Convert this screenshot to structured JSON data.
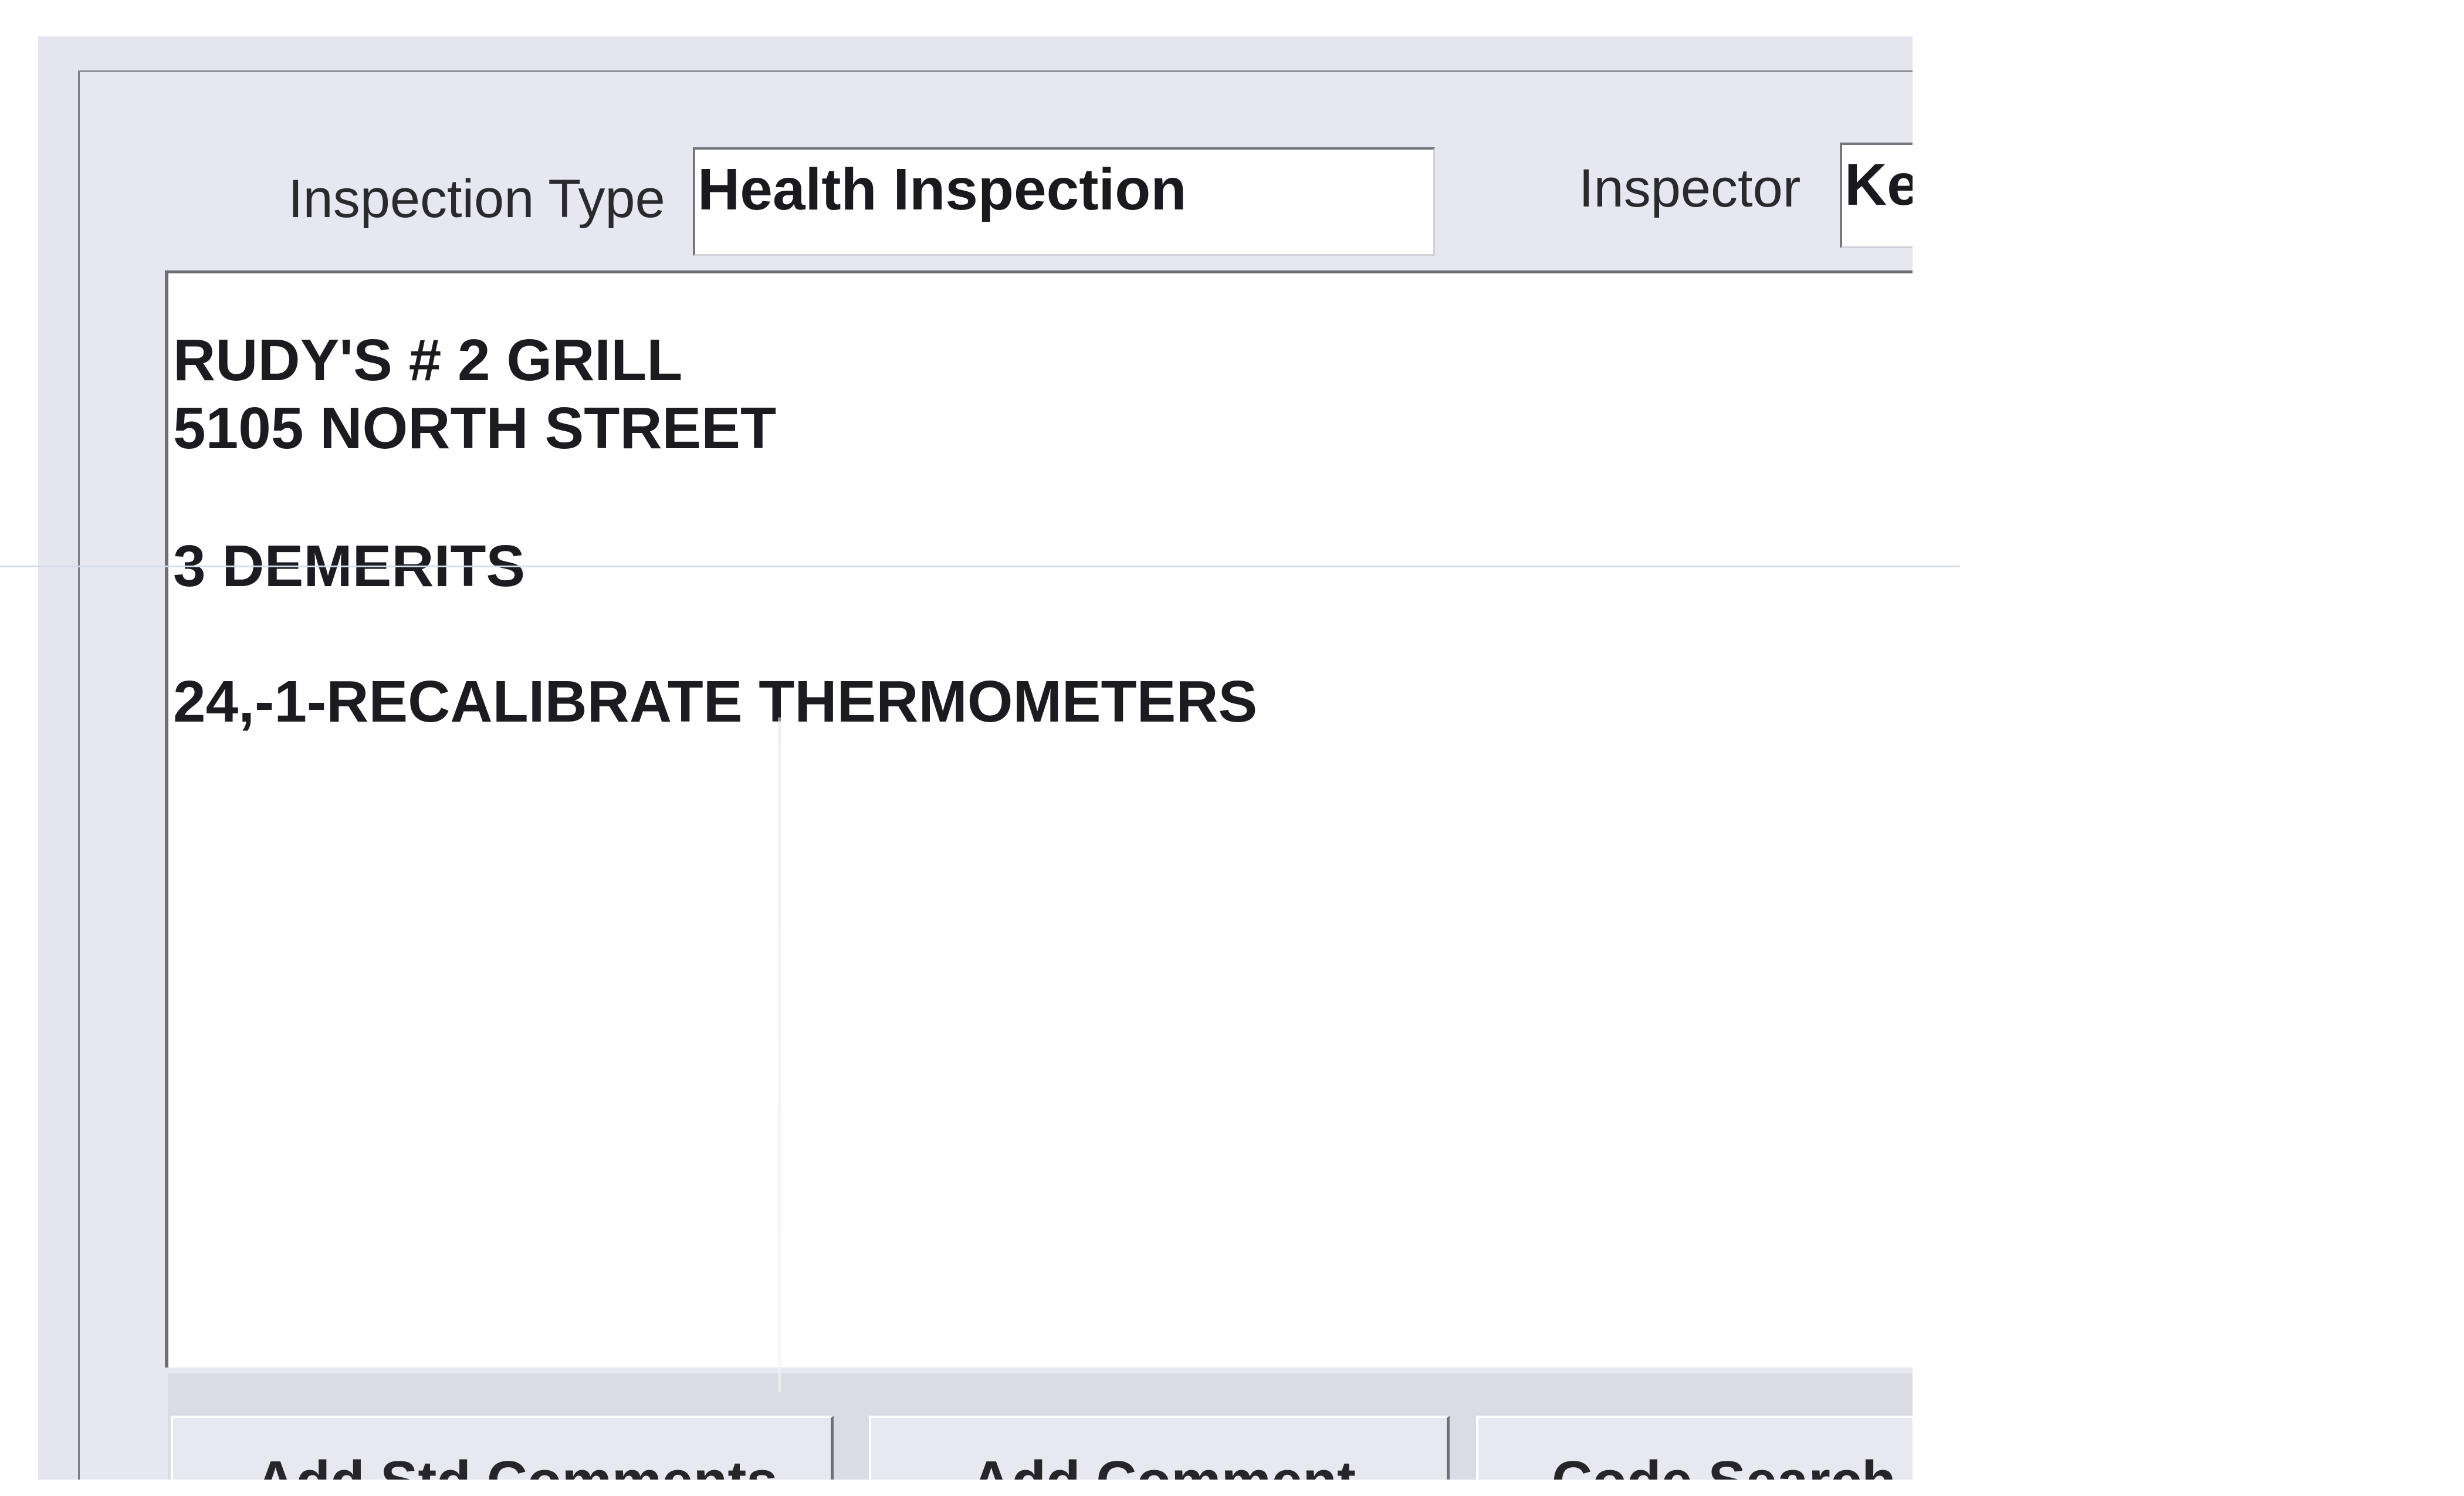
{
  "header": {
    "inspection_type_label": "Inspection Type",
    "inspection_type_value": "Health Inspection",
    "inspector_label": "Inspector",
    "inspector_value": "Ke"
  },
  "comments": {
    "lines": [
      "RUDY'S # 2 GRILL",
      "5105 NORTH STREET",
      "3 DEMERITS",
      "24,-1-RECALIBRATE THERMOMETERS"
    ]
  },
  "buttons": {
    "add_std_comments": {
      "pre": "Add ",
      "mnemonic": "S",
      "post": "td Comments"
    },
    "add_comment": {
      "pre": "",
      "mnemonic": "A",
      "post": "dd Comment"
    },
    "code_search": {
      "label": "Code Search Li"
    }
  }
}
